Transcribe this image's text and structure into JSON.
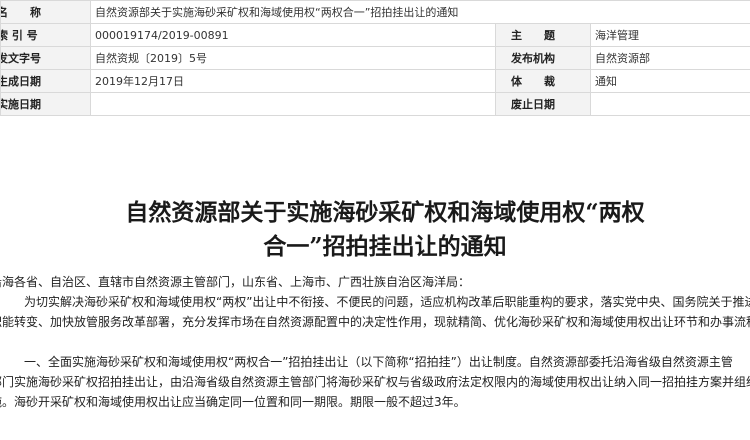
{
  "meta": {
    "rows": [
      {
        "label": "名　　称",
        "value": "自然资源部关于实施海砂采矿权和海域使用权“两权合一”招拍挂出让的通知"
      },
      {
        "label": "索 引 号",
        "value": "000019174/2019-00891",
        "label2": "主　　题",
        "value2": "海洋管理"
      },
      {
        "label": "发文字号",
        "value": "自然资规〔2019〕5号",
        "label2": "发布机构",
        "value2": "自然资源部"
      },
      {
        "label": "生成日期",
        "value": "2019年12月17日",
        "label2": "体　　裁",
        "value2": "通知"
      },
      {
        "label": "实施日期",
        "value": "",
        "label2": "废止日期",
        "value2": ""
      }
    ]
  },
  "doc": {
    "title_line1": "自然资源部关于实施海砂采矿权和海域使用权“两权",
    "title_line2": "合一”招拍挂出让的通知",
    "paragraphs": [
      "沿海各省、自治区、直辖市自然资源主管部门，山东省、上海市、广西壮族自治区海洋局：",
      "　为切实解决海砂采矿权和海域使用权“两权”出让中不衔接、不便民的问题，适应机构改革后职能重构的要求，落实党中央、国务院关于推进",
      "职能转变、加快放管服务改革部署，充分发挥市场在自然资源配置中的决定性作用，现就精简、优化海砂采矿权和海域使用权出让环节和办事流程，",
      "　一、全面实施海砂采矿权和海域使用权“两权合一”招拍挂出让（以下简称“招拍挂”）出让制度。自然资源部委托沿海省级自然资源主管",
      "部门实施海砂采矿权招拍挂出让，由沿海省级自然资源主管部门将海砂采矿权与省级政府法定权限内的海域使用权出让纳入同一招拍挂方案并组织实",
      "施。海砂开采矿权和海域使用权出让应当确定同一位置和同一期限。期限一般不超过3年。"
    ]
  }
}
